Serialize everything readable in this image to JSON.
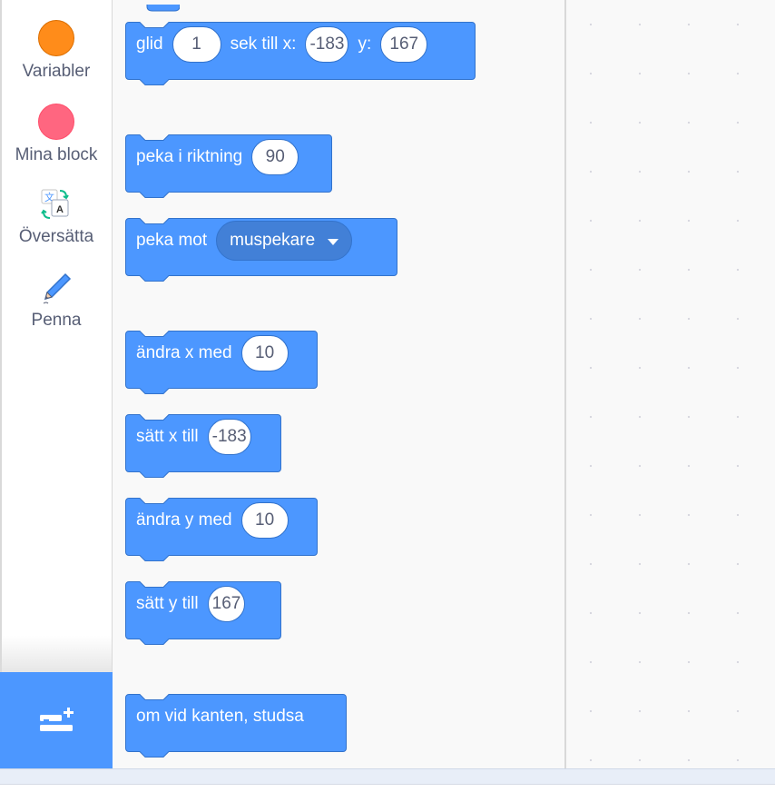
{
  "categories": [
    {
      "label": "Variabler",
      "color": "#ff8c1a",
      "icon": "orange-circle-icon"
    },
    {
      "label": "Mina block",
      "color": "#ff6680",
      "icon": "pink-circle-icon"
    },
    {
      "label": "Översätta",
      "icon": "translate-icon"
    },
    {
      "label": "Penna",
      "icon": "pen-icon"
    }
  ],
  "extension": {
    "icon": "add-extension-icon",
    "color": "#4c97ff"
  },
  "blocks": {
    "glide": {
      "text1": "glid",
      "secs": "1",
      "text2": "sek till x:",
      "x": "-183",
      "text3": "y:",
      "y": "167"
    },
    "point_direction": {
      "text": "peka i riktning",
      "value": "90"
    },
    "point_towards": {
      "text": "peka mot",
      "dropdown": "muspekare"
    },
    "change_x": {
      "text": "ändra x med",
      "value": "10"
    },
    "set_x": {
      "text": "sätt x till",
      "value": "-183"
    },
    "change_y": {
      "text": "ändra y med",
      "value": "10"
    },
    "set_y": {
      "text": "sätt y till",
      "value": "167"
    },
    "bounce": {
      "text": "om vid kanten, studsa"
    }
  },
  "colors": {
    "motion_block": "#4c97ff",
    "motion_border": "#3373cc",
    "text_dark": "#575e75"
  }
}
